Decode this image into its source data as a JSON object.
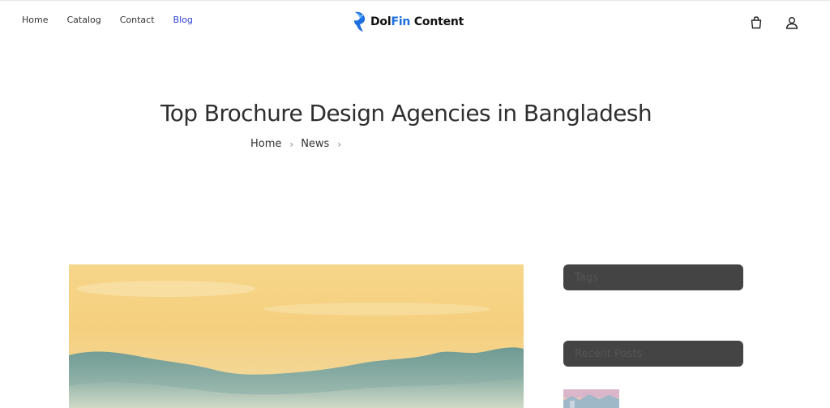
{
  "nav": {
    "items": [
      {
        "label": "Home",
        "active": false
      },
      {
        "label": "Catalog",
        "active": false
      },
      {
        "label": "Contact",
        "active": false
      },
      {
        "label": "Blog",
        "active": true
      }
    ]
  },
  "logo": {
    "part1": "Dol",
    "part2": "Fin",
    "part3": " Content",
    "brand_color": "#1d6fe0"
  },
  "header_icons": [
    "cart-icon",
    "user-icon"
  ],
  "page": {
    "title": "Top Brochure Design Agencies in Bangladesh",
    "breadcrumb": [
      {
        "label": "Home"
      },
      {
        "label": "News"
      }
    ]
  },
  "sidebar": {
    "tags_title": "Tags",
    "recent_title": "Recent Posts"
  },
  "colors": {
    "active_link": "#2d3fd6",
    "widget_bg": "#444444"
  }
}
